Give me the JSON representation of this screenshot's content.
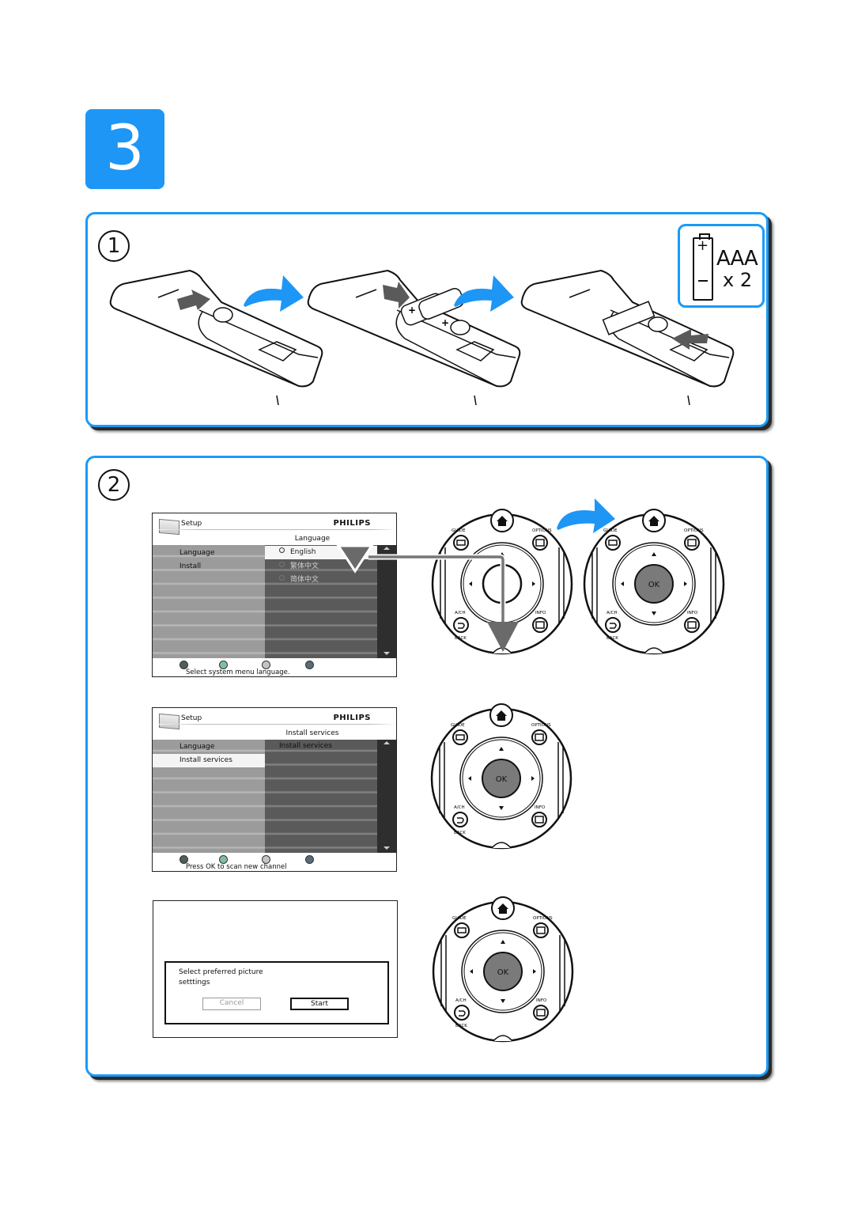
{
  "step": {
    "number": "3"
  },
  "panel1": {
    "label": "1",
    "battery": {
      "type": "AAA",
      "count": "x 2",
      "plus": "+",
      "minus": "−"
    },
    "icons": [
      "remote-back-cover-closed",
      "remote-cover-open-batteries",
      "remote-cover-closing"
    ]
  },
  "panel2": {
    "label": "2",
    "screen1": {
      "title": "Setup",
      "brand": "PHILIPS",
      "subtitle": "Language",
      "menu": [
        {
          "label": "Language",
          "selected": false
        },
        {
          "label": "Install",
          "selected": false
        }
      ],
      "options": [
        {
          "label": "English",
          "selected": true
        },
        {
          "label": "繁体中文",
          "selected": false
        },
        {
          "label": "简体中文",
          "selected": false
        }
      ],
      "status": "Select system menu language.",
      "color_keys": [
        "#4f5e5c",
        "#7fbfa0",
        "#c4c4c4",
        "#5a6b78"
      ]
    },
    "screen2": {
      "title": "Setup",
      "brand": "PHILIPS",
      "subtitle": "Install services",
      "menu": [
        {
          "label": "Language",
          "selected": false
        },
        {
          "label": "Install services",
          "selected": true
        }
      ],
      "options": [
        {
          "label": "Install services",
          "selected": false
        }
      ],
      "status": "Press OK to scan new channel",
      "color_keys": [
        "#4f5e5c",
        "#7fbfa0",
        "#c4c4c4",
        "#5a6b78"
      ]
    },
    "screen3": {
      "message": "Select preferred picture setttings",
      "cancel": "Cancel",
      "start": "Start"
    },
    "remote": {
      "guide": "GUIDE",
      "options": "OPTIONS",
      "ach": "A/CH",
      "info": "INFO",
      "back": "BACK",
      "ok": "OK"
    }
  },
  "colors": {
    "accent": "#1e96f5",
    "border": "#1a9af7",
    "ok_button": "#7a7a7a"
  }
}
